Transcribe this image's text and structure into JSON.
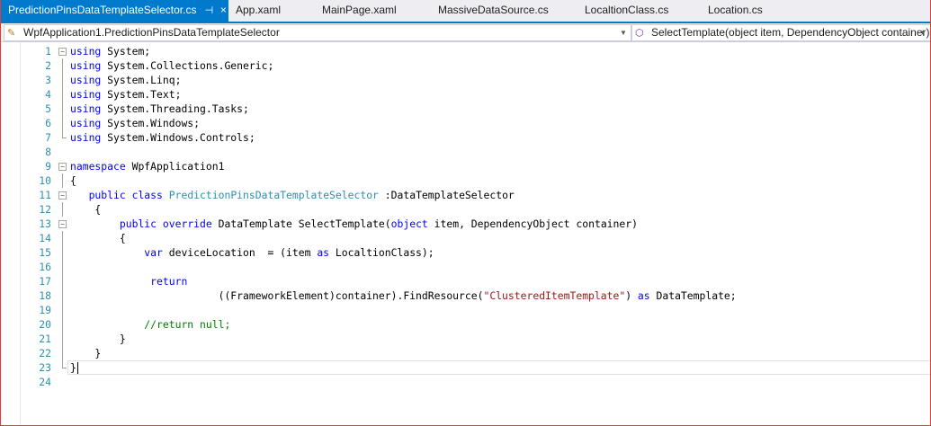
{
  "tabs": [
    {
      "label": "PredictionPinsDataTemplateSelector.cs",
      "active": true
    },
    {
      "label": "App.xaml"
    },
    {
      "label": "MainPage.xaml"
    },
    {
      "label": "MassiveDataSource.cs"
    },
    {
      "label": "LocaltionClass.cs"
    },
    {
      "label": "Location.cs"
    }
  ],
  "tab_icons": {
    "pin": "pin-icon",
    "close": "close-icon"
  },
  "nav": {
    "type_combo": "WpfApplication1.PredictionPinsDataTemplateSelector",
    "member_combo": "SelectTemplate(object item, DependencyObject container)"
  },
  "colors": {
    "accent": "#007acc",
    "keyword": "#0000ff",
    "type": "#2b91af",
    "string": "#a31515",
    "comment": "#008000",
    "line_number": "#2b91af"
  },
  "code_lines": [
    {
      "n": "1",
      "text": "using System;"
    },
    {
      "n": "2",
      "text": "using System.Collections.Generic;"
    },
    {
      "n": "3",
      "text": "using System.Linq;"
    },
    {
      "n": "4",
      "text": "using System.Text;"
    },
    {
      "n": "5",
      "text": "using System.Threading.Tasks;"
    },
    {
      "n": "6",
      "text": "using System.Windows;"
    },
    {
      "n": "7",
      "text": "using System.Windows.Controls;"
    },
    {
      "n": "8",
      "text": ""
    },
    {
      "n": "9",
      "text": "namespace WpfApplication1"
    },
    {
      "n": "10",
      "text": "{"
    },
    {
      "n": "11",
      "text": "   public class PredictionPinsDataTemplateSelector :DataTemplateSelector"
    },
    {
      "n": "12",
      "text": "    {"
    },
    {
      "n": "13",
      "text": "        public override DataTemplate SelectTemplate(object item, DependencyObject container)"
    },
    {
      "n": "14",
      "text": "        {"
    },
    {
      "n": "15",
      "text": "            var deviceLocation  = (item as LocaltionClass);"
    },
    {
      "n": "16",
      "text": ""
    },
    {
      "n": "17",
      "text": "             return"
    },
    {
      "n": "18",
      "text": "                        ((FrameworkElement)container).FindResource(\"ClusteredItemTemplate\") as DataTemplate;"
    },
    {
      "n": "19",
      "text": ""
    },
    {
      "n": "20",
      "text": "            //return null;"
    },
    {
      "n": "21",
      "text": "        }"
    },
    {
      "n": "22",
      "text": "    }"
    },
    {
      "n": "23",
      "text": "}"
    },
    {
      "n": "24",
      "text": ""
    }
  ],
  "current_line": "23"
}
